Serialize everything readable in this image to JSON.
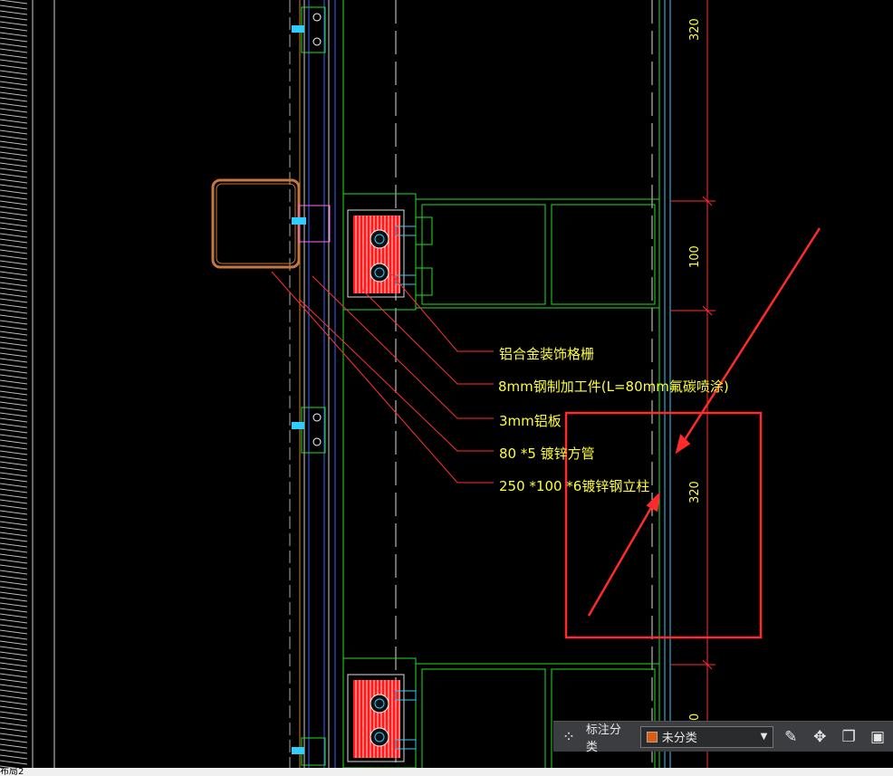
{
  "drawing": {
    "annotations": [
      "铝合金装饰格栅",
      "8mm钢制加工件(L=80mm氟碳喷涂)",
      "3mm铝板",
      "80 *5 镀锌方管",
      "250 *100 *6镀锌钢立柱"
    ],
    "dimensions": [
      "320",
      "100",
      "320",
      "0"
    ]
  },
  "toolbar": {
    "grid_icon": "grid-icon",
    "category_label": "标注分类",
    "category_value": "未分类",
    "category_swatch_color": "#e25a0c",
    "edit_icon": "edit-icon",
    "move_icon": "move-icon",
    "copy_icon": "copy-icon",
    "paste_icon": "paste-icon"
  },
  "statusbar": {
    "layout_tab": "布局2"
  },
  "colors": {
    "background": "#000000",
    "highlight": "#ff2a2a",
    "annotation_text": "#ffff33",
    "profile_green": "#22dd22"
  }
}
